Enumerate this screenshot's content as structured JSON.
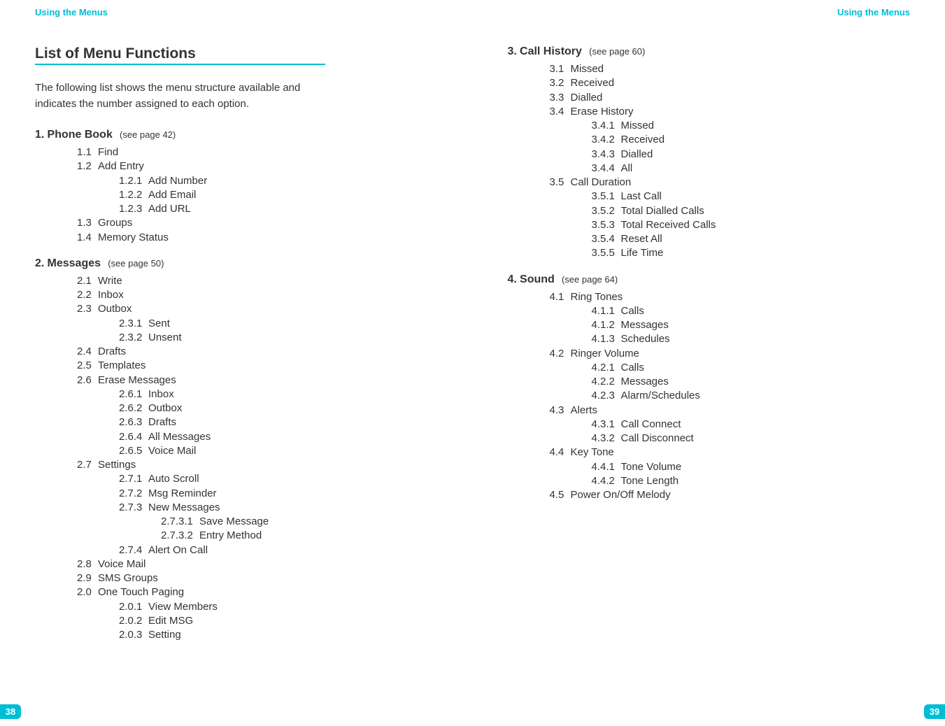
{
  "header": {
    "left": "Using the Menus",
    "right": "Using the Menus"
  },
  "pageNumbers": {
    "left": "38",
    "right": "39"
  },
  "sectionTitle": "List of Menu Functions",
  "intro": "The following list shows the menu structure available and indicates the number assigned to each option.",
  "menus": {
    "s1": {
      "num": "1.",
      "title": "Phone Book",
      "ref": "(see page 42)",
      "i1_1": {
        "n": "1.1",
        "t": "Find"
      },
      "i1_2": {
        "n": "1.2",
        "t": "Add Entry"
      },
      "i1_2_1": {
        "n": "1.2.1",
        "t": "Add Number"
      },
      "i1_2_2": {
        "n": "1.2.2",
        "t": "Add Email"
      },
      "i1_2_3": {
        "n": "1.2.3",
        "t": "Add URL"
      },
      "i1_3": {
        "n": "1.3",
        "t": "Groups"
      },
      "i1_4": {
        "n": "1.4",
        "t": "Memory Status"
      }
    },
    "s2": {
      "num": "2.",
      "title": "Messages",
      "ref": "(see page 50)",
      "i2_1": {
        "n": "2.1",
        "t": "Write"
      },
      "i2_2": {
        "n": "2.2",
        "t": "Inbox"
      },
      "i2_3": {
        "n": "2.3",
        "t": "Outbox"
      },
      "i2_3_1": {
        "n": "2.3.1",
        "t": "Sent"
      },
      "i2_3_2": {
        "n": "2.3.2",
        "t": "Unsent"
      },
      "i2_4": {
        "n": "2.4",
        "t": "Drafts"
      },
      "i2_5": {
        "n": "2.5",
        "t": "Templates"
      },
      "i2_6": {
        "n": "2.6",
        "t": "Erase Messages"
      },
      "i2_6_1": {
        "n": "2.6.1",
        "t": "Inbox"
      },
      "i2_6_2": {
        "n": "2.6.2",
        "t": "Outbox"
      },
      "i2_6_3": {
        "n": "2.6.3",
        "t": "Drafts"
      },
      "i2_6_4": {
        "n": "2.6.4",
        "t": "All Messages"
      },
      "i2_6_5": {
        "n": "2.6.5",
        "t": "Voice Mail"
      },
      "i2_7": {
        "n": "2.7",
        "t": "Settings"
      },
      "i2_7_1": {
        "n": "2.7.1",
        "t": "Auto Scroll"
      },
      "i2_7_2": {
        "n": "2.7.2",
        "t": "Msg Reminder"
      },
      "i2_7_3": {
        "n": "2.7.3",
        "t": "New Messages"
      },
      "i2_7_3_1": {
        "n": "2.7.3.1",
        "t": "Save Message"
      },
      "i2_7_3_2": {
        "n": "2.7.3.2",
        "t": "Entry Method"
      },
      "i2_7_4": {
        "n": "2.7.4",
        "t": "Alert On Call"
      },
      "i2_8": {
        "n": "2.8",
        "t": "Voice Mail"
      },
      "i2_9": {
        "n": "2.9",
        "t": "SMS Groups"
      },
      "i2_0": {
        "n": "2.0",
        "t": "One Touch Paging"
      },
      "i2_0_1": {
        "n": "2.0.1",
        "t": "View Members"
      },
      "i2_0_2": {
        "n": "2.0.2",
        "t": "Edit MSG"
      },
      "i2_0_3": {
        "n": "2.0.3",
        "t": "Setting"
      }
    },
    "s3": {
      "num": "3.",
      "title": "Call History",
      "ref": "(see page 60)",
      "i3_1": {
        "n": "3.1",
        "t": "Missed"
      },
      "i3_2": {
        "n": "3.2",
        "t": "Received"
      },
      "i3_3": {
        "n": "3.3",
        "t": "Dialled"
      },
      "i3_4": {
        "n": "3.4",
        "t": "Erase History"
      },
      "i3_4_1": {
        "n": "3.4.1",
        "t": "Missed"
      },
      "i3_4_2": {
        "n": "3.4.2",
        "t": "Received"
      },
      "i3_4_3": {
        "n": "3.4.3",
        "t": "Dialled"
      },
      "i3_4_4": {
        "n": "3.4.4",
        "t": "All"
      },
      "i3_5": {
        "n": "3.5",
        "t": "Call Duration"
      },
      "i3_5_1": {
        "n": "3.5.1",
        "t": "Last Call"
      },
      "i3_5_2": {
        "n": "3.5.2",
        "t": "Total Dialled Calls"
      },
      "i3_5_3": {
        "n": "3.5.3",
        "t": "Total Received Calls"
      },
      "i3_5_4": {
        "n": "3.5.4",
        "t": "Reset All"
      },
      "i3_5_5": {
        "n": "3.5.5",
        "t": "Life Time"
      }
    },
    "s4": {
      "num": "4.",
      "title": "Sound",
      "ref": "(see page 64)",
      "i4_1": {
        "n": "4.1",
        "t": "Ring Tones"
      },
      "i4_1_1": {
        "n": "4.1.1",
        "t": "Calls"
      },
      "i4_1_2": {
        "n": "4.1.2",
        "t": "Messages"
      },
      "i4_1_3": {
        "n": "4.1.3",
        "t": "Schedules"
      },
      "i4_2": {
        "n": "4.2",
        "t": "Ringer Volume"
      },
      "i4_2_1": {
        "n": "4.2.1",
        "t": "Calls"
      },
      "i4_2_2": {
        "n": "4.2.2",
        "t": "Messages"
      },
      "i4_2_3": {
        "n": "4.2.3",
        "t": "Alarm/Schedules"
      },
      "i4_3": {
        "n": "4.3",
        "t": "Alerts"
      },
      "i4_3_1": {
        "n": "4.3.1",
        "t": "Call Connect"
      },
      "i4_3_2": {
        "n": "4.3.2",
        "t": "Call Disconnect"
      },
      "i4_4": {
        "n": "4.4",
        "t": "Key Tone"
      },
      "i4_4_1": {
        "n": "4.4.1",
        "t": "Tone Volume"
      },
      "i4_4_2": {
        "n": "4.4.2",
        "t": "Tone Length"
      },
      "i4_5": {
        "n": "4.5",
        "t": "Power On/Off Melody"
      }
    }
  }
}
